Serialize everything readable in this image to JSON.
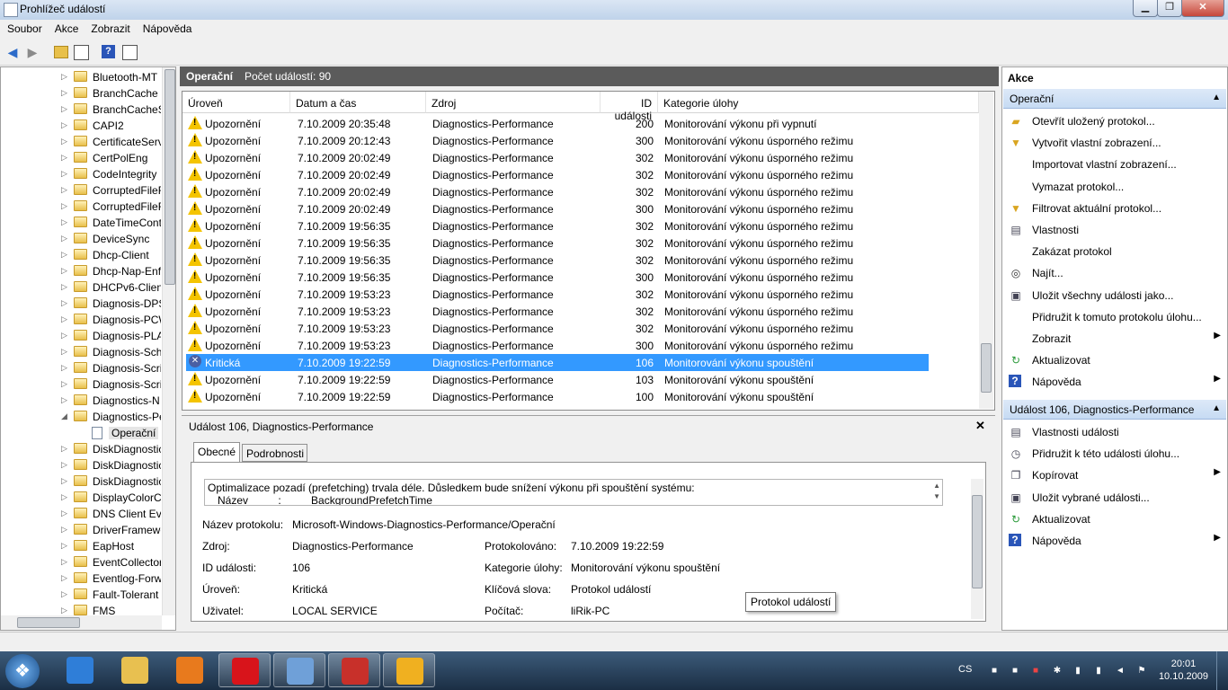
{
  "window": {
    "title": "Prohlížeč událostí",
    "minimize_glyph": "▁",
    "maximize_glyph": "❐",
    "close_glyph": "✕"
  },
  "menu": [
    "Soubor",
    "Akce",
    "Zobrazit",
    "Nápověda"
  ],
  "tree": {
    "items": [
      "Bluetooth-MT",
      "BranchCache",
      "BranchCacheS",
      "CAPI2",
      "CertificateServ",
      "CertPolEng",
      "CodeIntegrity",
      "CorruptedFileF",
      "CorruptedFileF",
      "DateTimeCont",
      "DeviceSync",
      "Dhcp-Client",
      "Dhcp-Nap-Enf",
      "DHCPv6-Clien",
      "Diagnosis-DPS",
      "Diagnosis-PCW",
      "Diagnosis-PLA",
      "Diagnosis-Sch",
      "Diagnosis-Scri",
      "Diagnosis-Scri",
      "Diagnostics-N",
      "Diagnostics-Pe"
    ],
    "selected_child": "Operační",
    "items_after": [
      "DiskDiagnostic",
      "DiskDiagnostic",
      "DiskDiagnostic",
      "DisplayColorC",
      "DNS Client Eve",
      "DriverFramewo",
      "EapHost",
      "EventCollector",
      "Eventlog-Forw",
      "Fault-Tolerant",
      "FMS"
    ]
  },
  "log_header": {
    "name": "Operační",
    "count_label": "Počet událostí: 90"
  },
  "columns": [
    "Úroveň",
    "Datum a čas",
    "Zdroj",
    "ID události",
    "Kategorie úlohy"
  ],
  "events": [
    {
      "level": "Upozornění",
      "type": "warning",
      "date": "7.10.2009 20:35:48",
      "source": "Diagnostics-Performance",
      "id": "200",
      "category": "Monitorování výkonu při vypnutí"
    },
    {
      "level": "Upozornění",
      "type": "warning",
      "date": "7.10.2009 20:12:43",
      "source": "Diagnostics-Performance",
      "id": "300",
      "category": "Monitorování výkonu úsporného režimu"
    },
    {
      "level": "Upozornění",
      "type": "warning",
      "date": "7.10.2009 20:02:49",
      "source": "Diagnostics-Performance",
      "id": "302",
      "category": "Monitorování výkonu úsporného režimu"
    },
    {
      "level": "Upozornění",
      "type": "warning",
      "date": "7.10.2009 20:02:49",
      "source": "Diagnostics-Performance",
      "id": "302",
      "category": "Monitorování výkonu úsporného režimu"
    },
    {
      "level": "Upozornění",
      "type": "warning",
      "date": "7.10.2009 20:02:49",
      "source": "Diagnostics-Performance",
      "id": "302",
      "category": "Monitorování výkonu úsporného režimu"
    },
    {
      "level": "Upozornění",
      "type": "warning",
      "date": "7.10.2009 20:02:49",
      "source": "Diagnostics-Performance",
      "id": "300",
      "category": "Monitorování výkonu úsporného režimu"
    },
    {
      "level": "Upozornění",
      "type": "warning",
      "date": "7.10.2009 19:56:35",
      "source": "Diagnostics-Performance",
      "id": "302",
      "category": "Monitorování výkonu úsporného režimu"
    },
    {
      "level": "Upozornění",
      "type": "warning",
      "date": "7.10.2009 19:56:35",
      "source": "Diagnostics-Performance",
      "id": "302",
      "category": "Monitorování výkonu úsporného režimu"
    },
    {
      "level": "Upozornění",
      "type": "warning",
      "date": "7.10.2009 19:56:35",
      "source": "Diagnostics-Performance",
      "id": "302",
      "category": "Monitorování výkonu úsporného režimu"
    },
    {
      "level": "Upozornění",
      "type": "warning",
      "date": "7.10.2009 19:56:35",
      "source": "Diagnostics-Performance",
      "id": "300",
      "category": "Monitorování výkonu úsporného režimu"
    },
    {
      "level": "Upozornění",
      "type": "warning",
      "date": "7.10.2009 19:53:23",
      "source": "Diagnostics-Performance",
      "id": "302",
      "category": "Monitorování výkonu úsporného režimu"
    },
    {
      "level": "Upozornění",
      "type": "warning",
      "date": "7.10.2009 19:53:23",
      "source": "Diagnostics-Performance",
      "id": "302",
      "category": "Monitorování výkonu úsporného režimu"
    },
    {
      "level": "Upozornění",
      "type": "warning",
      "date": "7.10.2009 19:53:23",
      "source": "Diagnostics-Performance",
      "id": "302",
      "category": "Monitorování výkonu úsporného režimu"
    },
    {
      "level": "Upozornění",
      "type": "warning",
      "date": "7.10.2009 19:53:23",
      "source": "Diagnostics-Performance",
      "id": "300",
      "category": "Monitorování výkonu úsporného režimu"
    },
    {
      "level": "Kritická",
      "type": "critical",
      "date": "7.10.2009 19:22:59",
      "source": "Diagnostics-Performance",
      "id": "106",
      "category": "Monitorování výkonu spouštění",
      "selected": true
    },
    {
      "level": "Upozornění",
      "type": "warning",
      "date": "7.10.2009 19:22:59",
      "source": "Diagnostics-Performance",
      "id": "103",
      "category": "Monitorování výkonu spouštění"
    },
    {
      "level": "Upozornění",
      "type": "warning",
      "date": "7.10.2009 19:22:59",
      "source": "Diagnostics-Performance",
      "id": "100",
      "category": "Monitorování výkonu spouštění"
    }
  ],
  "detail": {
    "title": "Událost 106, Diagnostics-Performance",
    "close_glyph": "✕",
    "tabs": [
      "Obecné",
      "Podrobnosti"
    ],
    "description": "Optimalizace pozadí (prefetching) trvala déle. Důsledkem bude snížení výkonu při spouštění systému:",
    "description_line2": "Název          :          BackgroundPrefetchTime",
    "fields_left": [
      {
        "label": "Název protokolu:",
        "value": "Microsoft-Windows-Diagnostics-Performance/Operační"
      },
      {
        "label": "Zdroj:",
        "value": "Diagnostics-Performance"
      },
      {
        "label": "ID události:",
        "value": "106"
      },
      {
        "label": "Úroveň:",
        "value": "Kritická"
      },
      {
        "label": "Uživatel:",
        "value": "LOCAL SERVICE"
      }
    ],
    "fields_right": [
      {
        "label": "Protokolováno:",
        "value": "7.10.2009 19:22:59"
      },
      {
        "label": "Kategorie úlohy:",
        "value": "Monitorování výkonu spouštění"
      },
      {
        "label": "Klíčová slova:",
        "value": "Protokol událostí"
      },
      {
        "label": "Počítač:",
        "value": "liRik-PC"
      }
    ],
    "tooltip": "Protokol událostí"
  },
  "actions": {
    "title": "Akce",
    "section1": "Operační",
    "items1": [
      {
        "label": "Otevřít uložený protokol...",
        "icon": "folder-open-icon"
      },
      {
        "label": "Vytvořit vlastní zobrazení...",
        "icon": "filter-icon"
      },
      {
        "label": "Importovat vlastní zobrazení...",
        "icon": ""
      },
      {
        "label": "Vymazat protokol...",
        "icon": ""
      },
      {
        "label": "Filtrovat aktuální protokol...",
        "icon": "filter-icon"
      },
      {
        "label": "Vlastnosti",
        "icon": "properties-icon"
      },
      {
        "label": "Zakázat protokol",
        "icon": ""
      },
      {
        "label": "Najít...",
        "icon": "binoculars-icon"
      },
      {
        "label": "Uložit všechny události jako...",
        "icon": "save-icon"
      },
      {
        "label": "Přidružit k tomuto protokolu úlohu...",
        "icon": ""
      },
      {
        "label": "Zobrazit",
        "icon": "",
        "submenu": true
      },
      {
        "label": "Aktualizovat",
        "icon": "refresh-icon"
      },
      {
        "label": "Nápověda",
        "icon": "help-icon",
        "submenu": true
      }
    ],
    "section2": "Událost 106, Diagnostics-Performance",
    "items2": [
      {
        "label": "Vlastnosti události",
        "icon": "properties-icon"
      },
      {
        "label": "Přidružit k této události úlohu...",
        "icon": "task-icon"
      },
      {
        "label": "Kopírovat",
        "icon": "copy-icon",
        "submenu": true
      },
      {
        "label": "Uložit vybrané události...",
        "icon": "save-icon"
      },
      {
        "label": "Aktualizovat",
        "icon": "refresh-icon"
      },
      {
        "label": "Nápověda",
        "icon": "help-icon",
        "submenu": true
      }
    ]
  },
  "taskbar": {
    "lang": "CS",
    "time": "20:01",
    "date": "10.10.2009",
    "start_glyph": "❖",
    "apps": [
      {
        "name": "ie-icon",
        "color": "#2f7ed8",
        "open": false
      },
      {
        "name": "explorer-icon",
        "color": "#e8c050",
        "open": false
      },
      {
        "name": "media-player-icon",
        "color": "#e87a1d",
        "open": false
      },
      {
        "name": "opera-icon",
        "color": "#d8141b",
        "open": true
      },
      {
        "name": "control-panel-icon",
        "color": "#6fa0d8",
        "open": true
      },
      {
        "name": "toolbox-icon",
        "color": "#c8302a",
        "open": true
      },
      {
        "name": "winamp-icon",
        "color": "#f0b020",
        "open": true
      }
    ]
  },
  "icons": {
    "back": "◀",
    "forward": "▶",
    "help": "?",
    "submenu": "▶",
    "collapse": "▲"
  }
}
